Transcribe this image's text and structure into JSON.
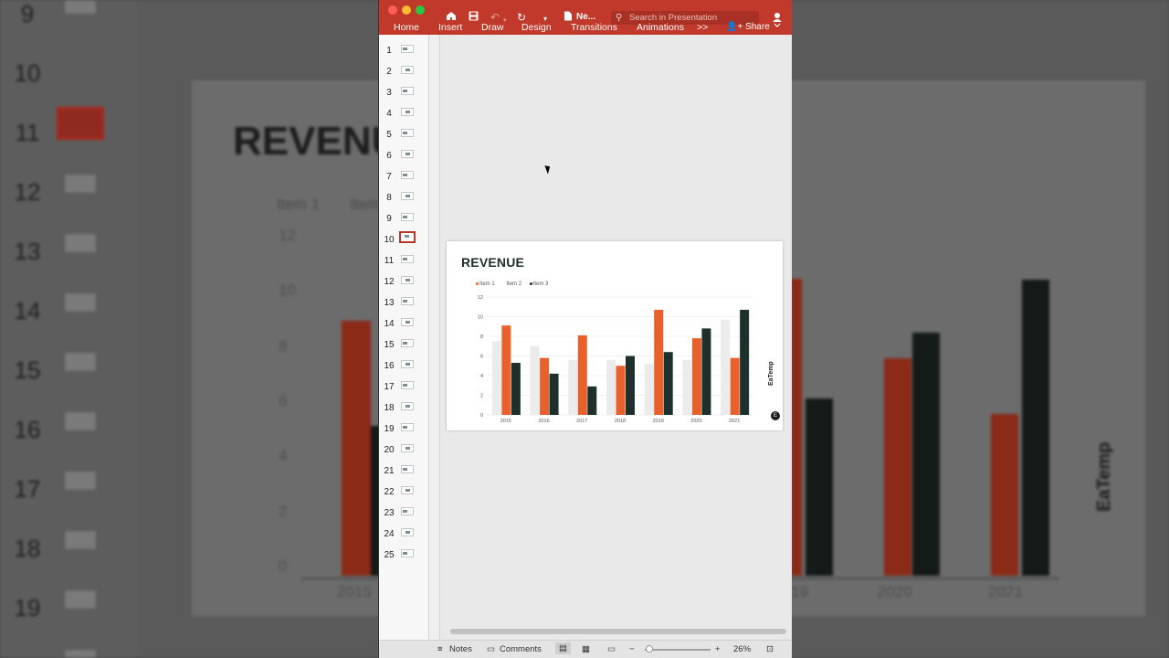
{
  "background": {
    "slide_numbers": [
      "9",
      "10",
      "11",
      "12",
      "13",
      "14",
      "15",
      "16",
      "17",
      "18",
      "19"
    ],
    "title": "REVENUE",
    "legend": [
      "Item 1",
      "Item"
    ],
    "y_ticks": [
      "12",
      "10",
      "8",
      "6",
      "4",
      "2",
      "0"
    ],
    "x_ticks": [
      "2015",
      "19",
      "2020",
      "2021"
    ],
    "logo": "EaTemp"
  },
  "toolbar": {
    "tabs": [
      {
        "label": "Home",
        "icon": "home-icon"
      },
      {
        "label": "Insert"
      },
      {
        "label": "Draw"
      },
      {
        "label": "Design"
      },
      {
        "label": "Transitions"
      },
      {
        "label": "Animations"
      }
    ],
    "more_label": ">>",
    "doc_name": "Ne...",
    "search_placeholder": "Search in Presentation",
    "share_label": "Share",
    "colors": {
      "ribbon": "#c0392b"
    }
  },
  "thumbnails": [
    "1",
    "2",
    "3",
    "4",
    "5",
    "6",
    "7",
    "8",
    "9",
    "10",
    "11",
    "12",
    "13",
    "14",
    "15",
    "16",
    "17",
    "18",
    "19",
    "20",
    "21",
    "22",
    "23",
    "24",
    "25"
  ],
  "selected_slide": "10",
  "slide": {
    "title": "REVENUE",
    "logo": "EaTemp"
  },
  "chart_data": {
    "type": "bar",
    "title": "REVENUE",
    "categories": [
      "2015",
      "2016",
      "2017",
      "2018",
      "2019",
      "2020",
      "2021"
    ],
    "series": [
      {
        "name": "Item 1",
        "color": "#ebebeb",
        "values": [
          7.5,
          7,
          5.6,
          5.6,
          5.2,
          5.6,
          9.7
        ]
      },
      {
        "name": "Item 2",
        "color": "#e8602c",
        "values": [
          9.1,
          5.8,
          8.1,
          5.0,
          10.7,
          7.8,
          5.8
        ]
      },
      {
        "name": "Item 3",
        "color": "#1e302b",
        "values": [
          5.3,
          4.2,
          2.9,
          6.0,
          6.4,
          8.8,
          10.7
        ]
      }
    ],
    "yticks": [
      "0",
      "2",
      "4",
      "6",
      "8",
      "10",
      "12"
    ],
    "ylim": [
      0,
      12
    ],
    "grid": true,
    "legend_position": "top-left"
  },
  "statusbar": {
    "notes_label": "Notes",
    "comments_label": "Comments",
    "zoom_out": "−",
    "zoom_in": "+",
    "zoom_level": "26%"
  }
}
